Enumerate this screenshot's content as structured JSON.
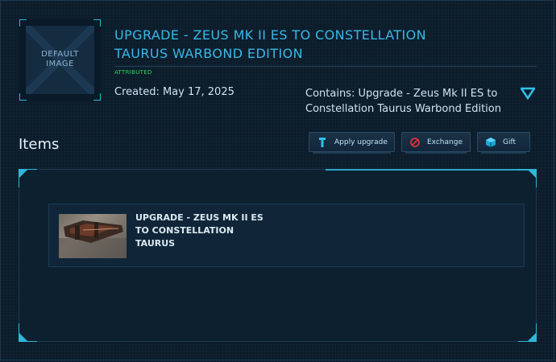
{
  "thumbnail": {
    "caption_line1": "DEFAULT",
    "caption_line2": "IMAGE"
  },
  "header": {
    "title": "UPGRADE - ZEUS MK II ES TO CONSTELLATION TAURUS WARBOND EDITION",
    "badge": "ATTRIBUTED",
    "created": "Created: May 17, 2025",
    "contains": "Contains: Upgrade - Zeus Mk II ES to Constellation Taurus Warbond Edition"
  },
  "items_section": {
    "label": "Items",
    "buttons": {
      "apply": "Apply upgrade",
      "exchange": "Exchange",
      "gift": "Gift"
    }
  },
  "items": [
    {
      "name": "UPGRADE - ZEUS MK II ES TO CONSTELLATION TAURUS"
    }
  ],
  "colors": {
    "accent": "#39b8e6",
    "badge": "#2dd35a",
    "background": "#0b1c2b"
  },
  "icons": {
    "expand": "chevron-down-icon",
    "apply": "upgrade-tool-icon",
    "exchange": "exchange-icon",
    "gift": "gift-icon"
  }
}
